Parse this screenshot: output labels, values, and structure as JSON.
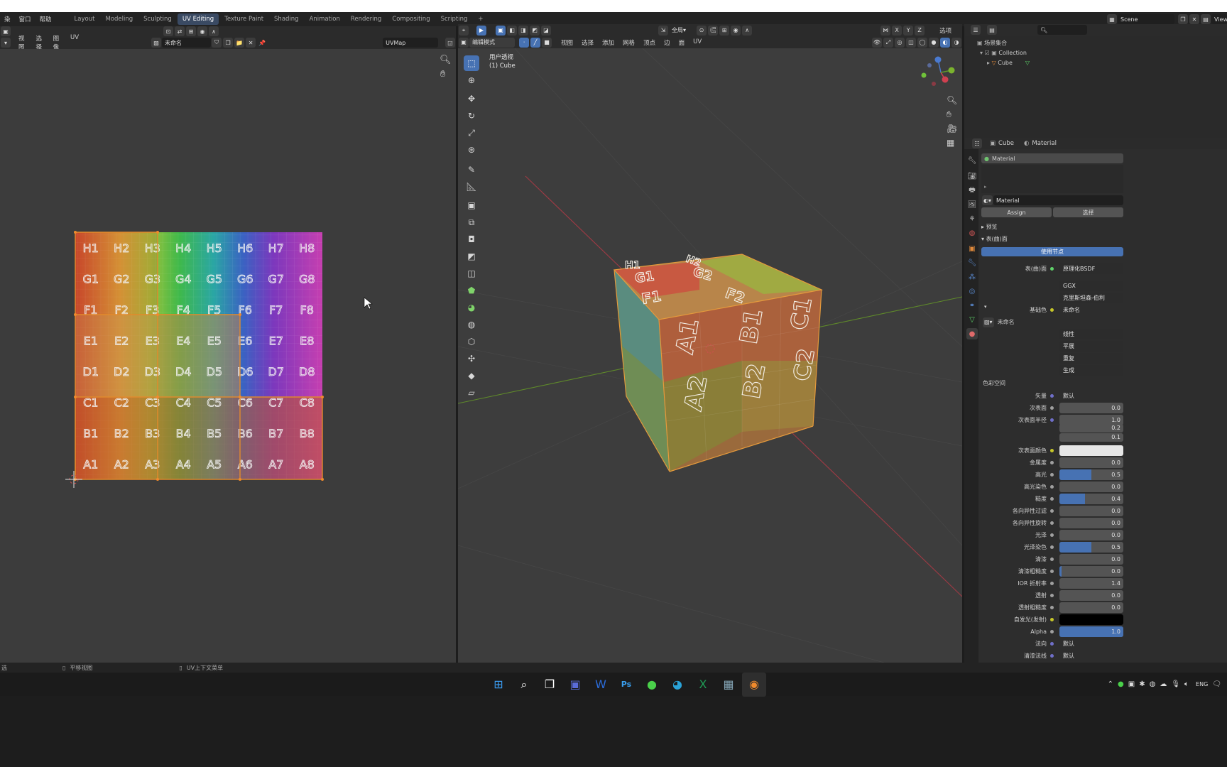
{
  "topmenu": {
    "render": "染",
    "window": "窗口",
    "help": "帮助"
  },
  "workspaces": [
    {
      "label": "Layout"
    },
    {
      "label": "Modeling"
    },
    {
      "label": "Sculpting"
    },
    {
      "label": "UV Editing",
      "active": true
    },
    {
      "label": "Texture Paint"
    },
    {
      "label": "Shading"
    },
    {
      "label": "Animation"
    },
    {
      "label": "Rendering"
    },
    {
      "label": "Compositing"
    },
    {
      "label": "Scripting"
    }
  ],
  "top_right": {
    "scene": "Scene",
    "view_layer": "View"
  },
  "uv_editor": {
    "menus": [
      "视图",
      "选择",
      "图像",
      "UV"
    ],
    "image_name": "未命名",
    "uvmap": "UVMap",
    "grid_cols": [
      "1",
      "2",
      "3",
      "4",
      "5",
      "6",
      "7",
      "8"
    ],
    "grid_rows": [
      "H",
      "G",
      "F",
      "E",
      "D",
      "C",
      "B",
      "A"
    ]
  },
  "viewport": {
    "mode": "编辑模式",
    "menus": [
      "视图",
      "选择",
      "添加",
      "网格",
      "顶点",
      "边",
      "面",
      "UV"
    ],
    "view_name": "用户透视",
    "object_label": "(1) Cube",
    "pivot": "全局",
    "options": "选项",
    "axes": [
      "X",
      "Y",
      "Z"
    ]
  },
  "outliner": {
    "scene_collection": "场景集合",
    "collection": "Collection",
    "object": "Cube"
  },
  "properties": {
    "breadcrumb": [
      "Cube",
      "Material"
    ],
    "slot_material": "Material",
    "material_name": "Material",
    "assign": "Assign",
    "select": "选择",
    "preview": "预览",
    "surface_section": "表(曲)面",
    "use_nodes": "使用节点",
    "surface_label": "表(曲)面",
    "surface_value": "原理化BSDF",
    "distribution": "GGX",
    "subsurface_method": "克里斯坦森-伯利",
    "base_color_label": "基础色",
    "base_color_value": "未命名",
    "image_name": "未命名",
    "interp": "线性",
    "projection": "平展",
    "extension": "重复",
    "source": "生成",
    "colorspace": "色彩空间",
    "rows": [
      {
        "label": "矢量",
        "value": "默认",
        "kind": "text",
        "dot": "#6f6fc9"
      },
      {
        "label": "次表面",
        "value": "0.0",
        "kind": "num",
        "fill": 0,
        "dot": "#a0a0a0"
      },
      {
        "label": "次表面半径",
        "value": "1.0",
        "kind": "vec",
        "dot": "#6f6fc9",
        "extra": [
          "0.2",
          "0.1"
        ]
      },
      {
        "label": "次表面颜色",
        "value": "",
        "kind": "color",
        "color": "#e6e6e6",
        "dot": "#c7c729"
      },
      {
        "label": "金属度",
        "value": "0.0",
        "kind": "num",
        "fill": 0,
        "dot": "#a0a0a0"
      },
      {
        "label": "高光",
        "value": "0.5",
        "kind": "num",
        "fill": 0.5,
        "dot": "#a0a0a0"
      },
      {
        "label": "高光染色",
        "value": "0.0",
        "kind": "num",
        "fill": 0,
        "dot": "#a0a0a0"
      },
      {
        "label": "糙度",
        "value": "0.4",
        "kind": "num",
        "fill": 0.4,
        "dot": "#a0a0a0"
      },
      {
        "label": "各向异性过滤",
        "value": "0.0",
        "kind": "num",
        "fill": 0,
        "dot": "#a0a0a0"
      },
      {
        "label": "各向异性旋转",
        "value": "0.0",
        "kind": "num",
        "fill": 0,
        "dot": "#a0a0a0"
      },
      {
        "label": "光泽",
        "value": "0.0",
        "kind": "num",
        "fill": 0,
        "dot": "#a0a0a0"
      },
      {
        "label": "光泽染色",
        "value": "0.5",
        "kind": "num",
        "fill": 0.5,
        "dot": "#a0a0a0"
      },
      {
        "label": "清漆",
        "value": "0.0",
        "kind": "num",
        "fill": 0,
        "dot": "#a0a0a0"
      },
      {
        "label": "清漆粗糙度",
        "value": "0.0",
        "kind": "num",
        "fill": 0.03,
        "dot": "#a0a0a0"
      },
      {
        "label": "IOR 折射率",
        "value": "1.4",
        "kind": "num",
        "fill": 0,
        "dot": "#a0a0a0"
      },
      {
        "label": "透射",
        "value": "0.0",
        "kind": "num",
        "fill": 0,
        "dot": "#a0a0a0"
      },
      {
        "label": "透射粗糙度",
        "value": "0.0",
        "kind": "num",
        "fill": 0,
        "dot": "#a0a0a0"
      },
      {
        "label": "自发光(发射)",
        "value": "",
        "kind": "color",
        "color": "#000000",
        "dot": "#c7c729"
      },
      {
        "label": "Alpha",
        "value": "1.0",
        "kind": "num",
        "fill": 1,
        "dot": "#a0a0a0"
      },
      {
        "label": "法向",
        "value": "默认",
        "kind": "text",
        "dot": "#6f6fc9"
      },
      {
        "label": "清漆法线",
        "value": "默认",
        "kind": "text",
        "dot": "#6f6fc9"
      }
    ]
  },
  "statusbar": {
    "left": "选",
    "pan": "平移视图",
    "uv_menu": "UV上下文菜单"
  },
  "taskbar": {
    "lang": "ENG"
  }
}
